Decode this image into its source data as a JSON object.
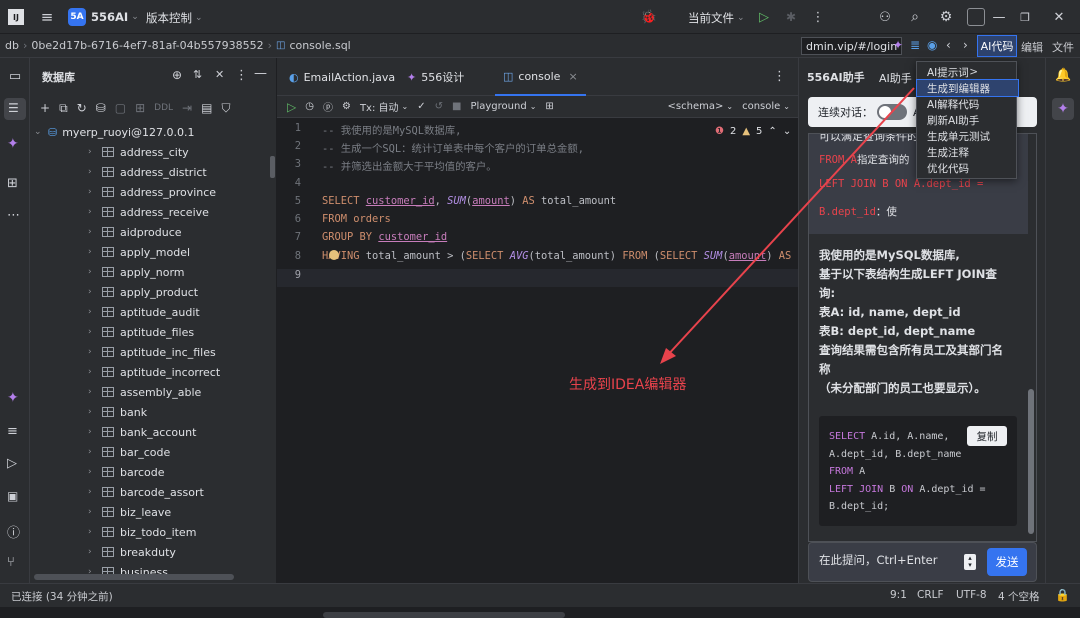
{
  "titlebar": {
    "project_badge": "5A",
    "project_name": "556AI",
    "vcs_label": "版本控制",
    "current_file_label": "当前文件"
  },
  "breadcrumbs": {
    "db": "db",
    "id": "0be2d17b-6716-4ef7-81af-04b557938552",
    "file": "console.sql",
    "url": "dmin.vip/#/login",
    "menu_ai": "AI代码",
    "menu_edit": "编辑",
    "menu_file": "文件"
  },
  "db_panel": {
    "title": "数据库",
    "ddl_label": "DDL",
    "root": "myerp_ruoyi@127.0.0.1",
    "tables": [
      "address_city",
      "address_district",
      "address_province",
      "address_receive",
      "aidproduce",
      "apply_model",
      "apply_norm",
      "apply_product",
      "aptitude_audit",
      "aptitude_files",
      "aptitude_inc_files",
      "aptitude_incorrect",
      "assembly_able",
      "bank",
      "bank_account",
      "bar_code",
      "barcode",
      "barcode_assort",
      "biz_leave",
      "biz_todo_item",
      "breakduty",
      "business"
    ]
  },
  "editor": {
    "tabs": [
      "EmailAction.java",
      "556设计",
      "console"
    ],
    "toolbar": {
      "tx": "Tx: 自动",
      "playground": "Playground",
      "schema": "<schema>",
      "console": "console"
    },
    "inspections": {
      "warnings": "2",
      "weak": "5"
    },
    "lines": [
      {
        "n": "1",
        "text": "-- 我使用的是MySQL数据库,"
      },
      {
        "n": "2",
        "text": "-- 生成一个SQL：统计订单表中每个客户的订单总金额,"
      },
      {
        "n": "3",
        "text": "-- 并筛选出金额大于平均值的客户。"
      },
      {
        "n": "4",
        "text": ""
      },
      {
        "n": "5",
        "k1": "SELECT ",
        "i1": "customer_id",
        ", ": "",
        "f1": "SUM",
        "p1": "(",
        "i2": "amount",
        "rest": ") AS total_amount"
      },
      {
        "n": "6",
        "k1": "FROM ",
        "rest": "orders"
      },
      {
        "n": "7",
        "k1": "GROUP BY ",
        "i1": "customer_id"
      },
      {
        "n": "8",
        "k1": "HAVING ",
        "rest": "total_amount > ("
      },
      {
        "n": "9",
        "text": ""
      }
    ],
    "annotation": "生成到IDEA编辑器"
  },
  "ai_panel": {
    "title": "556AI助手",
    "tab": "AI助手",
    "toggle_label": "连续对话：",
    "toggle_suffix": "AI",
    "snippet_top": "可以满足查询条件的",
    "snippet_from": "FROM A",
    "snippet_from_note": "指定查询的",
    "snippet_join": "LEFT JOIN B ON A.dept_id =",
    "snippet_join2": "B.dept_id",
    "snippet_join2_note": "：使",
    "message": [
      "我使用的是MySQL数据库,",
      "基于以下表结构生成LEFT JOIN查",
      "询:",
      "表A: id, name, dept_id",
      "表B: dept_id, dept_name",
      "查询结果需包含所有员工及其部门名",
      "称",
      "（未分配部门的员工也要显示）。"
    ],
    "code": [
      "SELECT A.id, A.name,",
      "A.dept_id, B.dept_name",
      "FROM A",
      "LEFT JOIN B ON A.dept_id =",
      "B.dept_id;"
    ],
    "copy_label": "复制",
    "input_placeholder": "在此提问，Ctrl+Enter",
    "send_label": "发送"
  },
  "context_menu": {
    "items": [
      "AI提示词",
      "生成到编辑器",
      "AI解释代码",
      "刷新AI助手",
      "生成单元测试",
      "生成注释",
      "优化代码"
    ],
    "submenu_arrow": ">"
  },
  "status": {
    "connection": "已连接 (34 分钟之前)",
    "position": "9:1",
    "line_sep": "CRLF",
    "encoding": "UTF-8",
    "indent": "4 个空格"
  },
  "colors": {
    "accent": "#3574f0",
    "annotation": "#e8434c",
    "keyword": "#cf8e6d",
    "identifier": "#c77dbb"
  }
}
